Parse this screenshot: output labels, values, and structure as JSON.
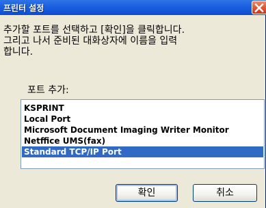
{
  "window": {
    "title": "프린터 설정"
  },
  "instructions": {
    "line1": "추가할 포트를 선택하고 [확인]을 클릭합니다.",
    "line2": "그리고 나서 준비된 대화상자에 이름을 입력",
    "line3": "합니다."
  },
  "add_port": {
    "label": "포트 추가:"
  },
  "ports": {
    "items": [
      {
        "label": "KSPRINT",
        "selected": false
      },
      {
        "label": "Local Port",
        "selected": false
      },
      {
        "label": "Microsoft Document Imaging Writer Monitor",
        "selected": false
      },
      {
        "label": "Netffice UMS(fax)",
        "selected": false
      },
      {
        "label": "Standard TCP/IP Port",
        "selected": true
      }
    ]
  },
  "buttons": {
    "ok_label": "확인",
    "cancel_label": "취소"
  },
  "colors": {
    "titlebar": "#1b5fe0",
    "selection": "#316ac5",
    "dialog_bg": "#ece9d8",
    "close_button": "#e0583a"
  },
  "icons": {
    "close": "close-icon"
  }
}
